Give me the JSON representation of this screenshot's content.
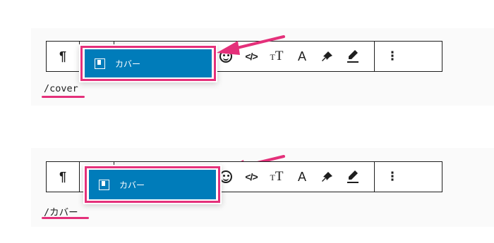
{
  "example1": {
    "toolbar": {
      "paragraph_symbol": "¶",
      "more_symbol": "⋮"
    },
    "dropdown": {
      "option_label": "カバー",
      "option_icon": "cover-block-icon"
    },
    "typed_text": "/cover"
  },
  "example2": {
    "toolbar": {
      "paragraph_symbol": "¶",
      "more_symbol": "⋮"
    },
    "dropdown": {
      "option_label": "カバー",
      "option_icon": "cover-block-icon"
    },
    "typed_text": "/カバー"
  },
  "toolbar_icons": [
    "color-circle-icon",
    "emoji-icon",
    "inline-code-icon",
    "text-size-icon",
    "text-color-icon",
    "pin-icon",
    "highlight-icon",
    "more-options-icon"
  ],
  "colors": {
    "accent": "#e4307a",
    "option_bg": "#007cba",
    "text": "#1e1e1e"
  }
}
